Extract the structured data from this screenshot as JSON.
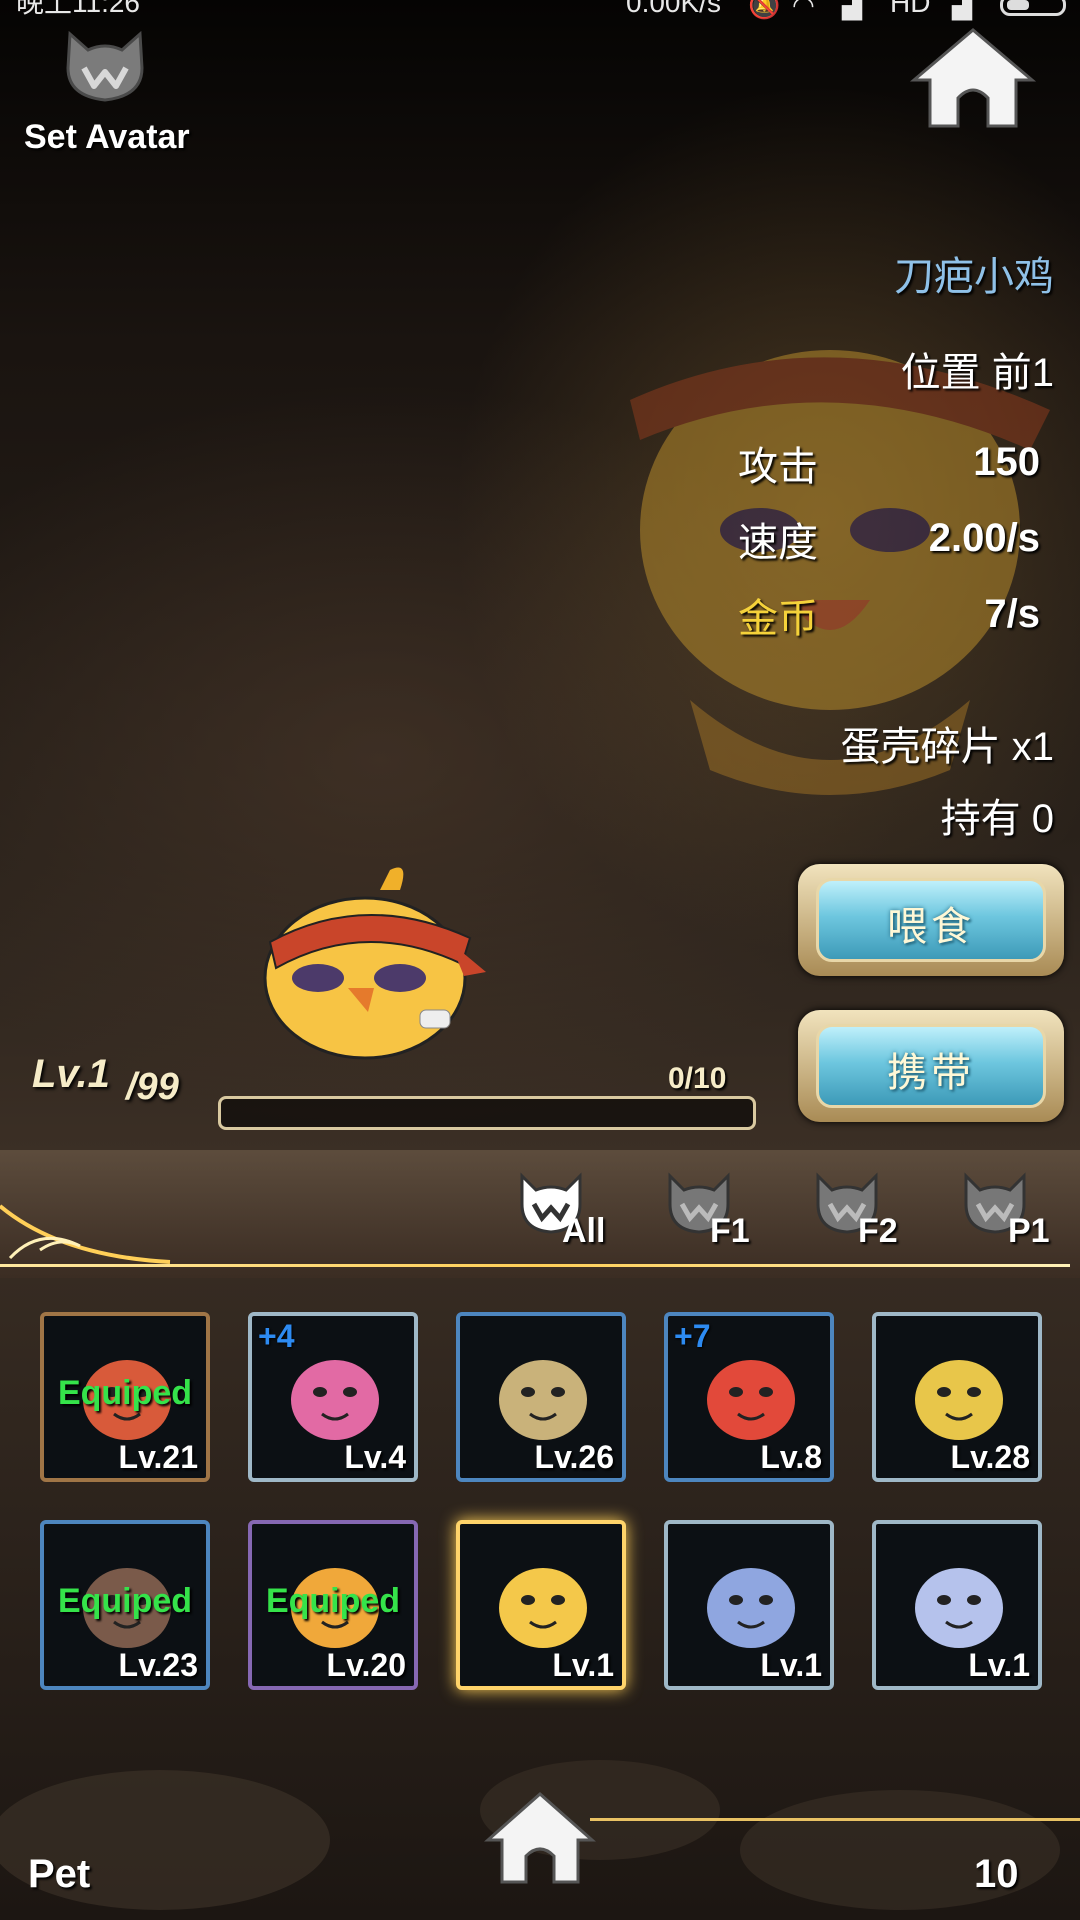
{
  "status_bar": {
    "time": "晚上11:26",
    "network_speed": "0.00K/s",
    "hd_label": "HD"
  },
  "header": {
    "set_avatar_label": "Set Avatar"
  },
  "pet_info": {
    "name": "刀疤小鸡",
    "position": "位置 前1",
    "attack_label": "攻击",
    "attack_value": "150",
    "speed_label": "速度",
    "speed_value": "2.00/s",
    "gold_label": "金币",
    "gold_value": "7/s",
    "shard_line": "蛋壳碎片 x1",
    "owned_line": "持有 0"
  },
  "actions": {
    "feed_label": "喂食",
    "carry_label": "携带"
  },
  "level": {
    "current": "Lv.1",
    "max": "/99",
    "xp_text": "0/10",
    "xp_fraction": 0
  },
  "filters": [
    {
      "label": "All"
    },
    {
      "label": "F1"
    },
    {
      "label": "F2"
    },
    {
      "label": "P1"
    }
  ],
  "pets": [
    {
      "level": "Lv.21",
      "equipped": "Equiped",
      "plus": "",
      "frame": "bronze",
      "color": "#d85a3a"
    },
    {
      "level": "Lv.4",
      "equipped": "",
      "plus": "+4",
      "frame": "silver",
      "color": "#e26aa4"
    },
    {
      "level": "Lv.26",
      "equipped": "",
      "plus": "",
      "frame": "blue",
      "color": "#c9b27a"
    },
    {
      "level": "Lv.8",
      "equipped": "",
      "plus": "+7",
      "frame": "blue",
      "color": "#e2493a"
    },
    {
      "level": "Lv.28",
      "equipped": "",
      "plus": "",
      "frame": "silver",
      "color": "#e8c64a"
    },
    {
      "level": "Lv.23",
      "equipped": "Equiped",
      "plus": "",
      "frame": "blue",
      "color": "#7a5a4a"
    },
    {
      "level": "Lv.20",
      "equipped": "Equiped",
      "plus": "",
      "frame": "purple",
      "color": "#f0a83a"
    },
    {
      "level": "Lv.1",
      "equipped": "",
      "plus": "",
      "frame": "selected",
      "color": "#f4c84a"
    },
    {
      "level": "Lv.1",
      "equipped": "",
      "plus": "",
      "frame": "silver",
      "color": "#8fa6e0"
    },
    {
      "level": "Lv.1",
      "equipped": "",
      "plus": "",
      "frame": "silver",
      "color": "#b5c2ec"
    }
  ],
  "footer": {
    "label": "Pet",
    "count": "10"
  }
}
